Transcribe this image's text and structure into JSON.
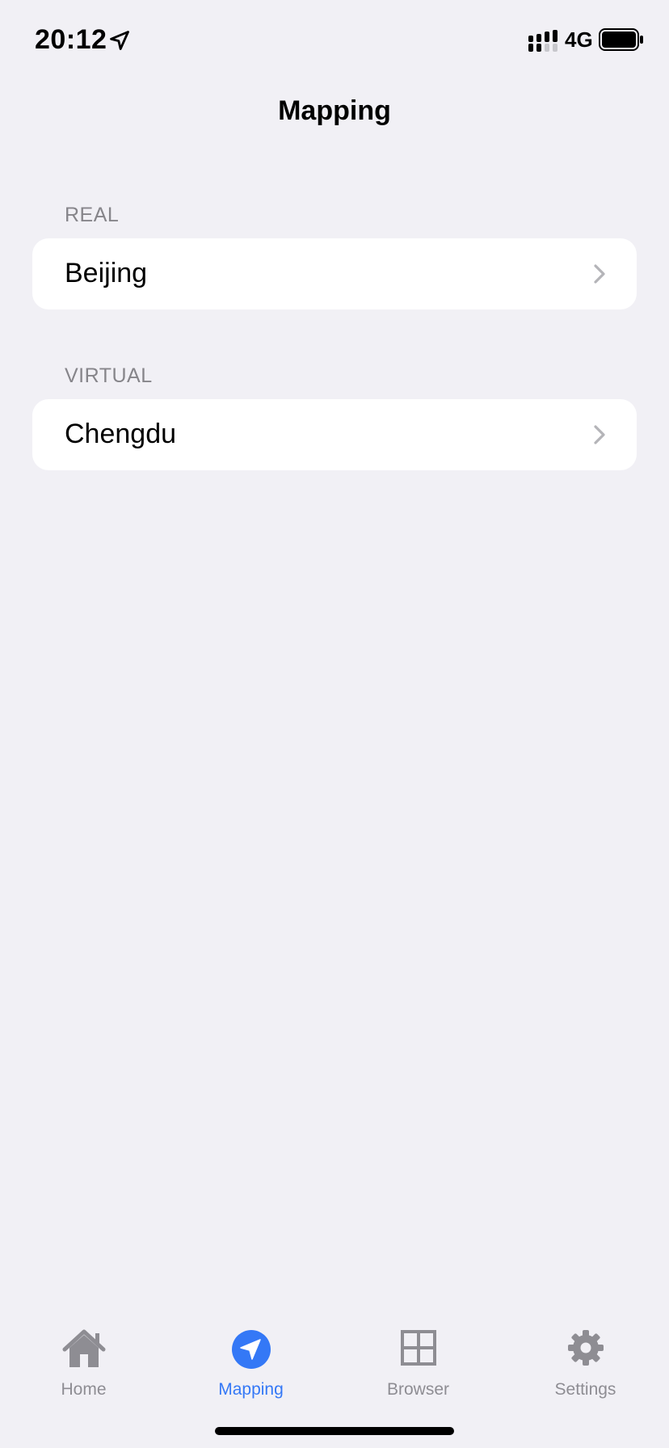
{
  "status_bar": {
    "time": "20:12",
    "network": "4G"
  },
  "nav": {
    "title": "Mapping"
  },
  "sections": [
    {
      "header": "REAL",
      "rows": [
        {
          "label": "Beijing"
        }
      ]
    },
    {
      "header": "VIRTUAL",
      "rows": [
        {
          "label": "Chengdu"
        }
      ]
    }
  ],
  "tab_bar": {
    "items": [
      {
        "label": "Home",
        "icon": "house-icon",
        "active": false
      },
      {
        "label": "Mapping",
        "icon": "location-arrow-icon",
        "active": true
      },
      {
        "label": "Browser",
        "icon": "grid-icon",
        "active": false
      },
      {
        "label": "Settings",
        "icon": "gear-icon",
        "active": false
      }
    ]
  },
  "colors": {
    "background": "#F1F0F5",
    "cell_background": "#FFFFFF",
    "accent": "#3478F6",
    "secondary_text": "#86858A",
    "inactive_tab": "#8E8D93"
  }
}
